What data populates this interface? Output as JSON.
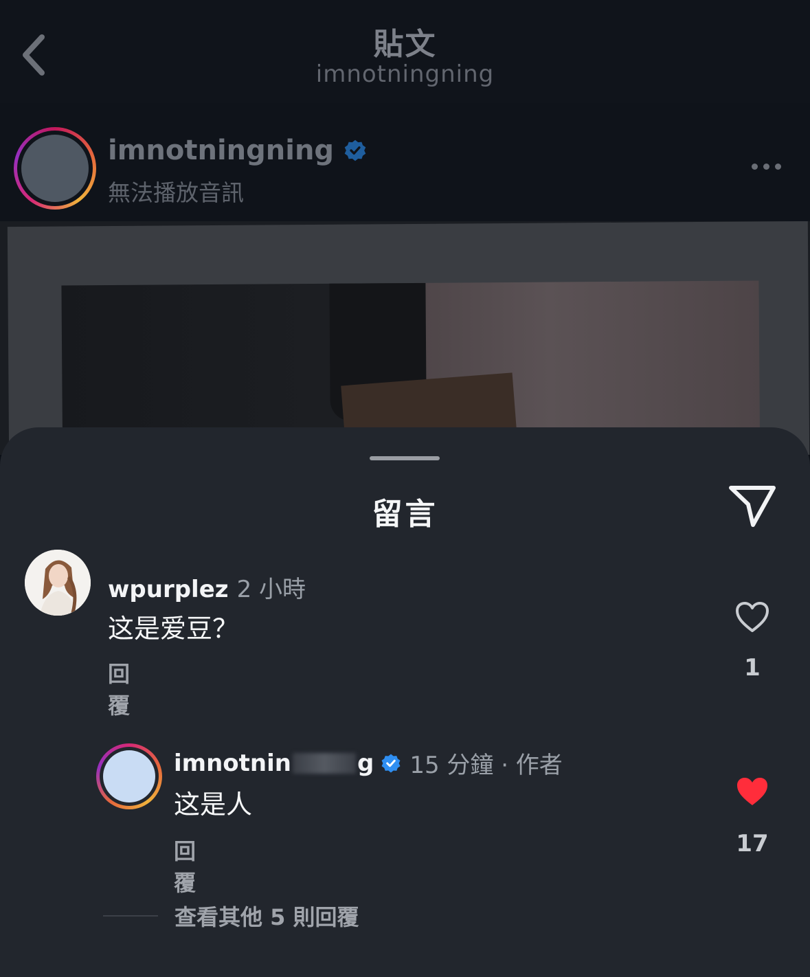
{
  "header": {
    "title": "貼文",
    "subtitle": "imnotningning"
  },
  "post": {
    "username": "imnotningning",
    "audio_status": "無法播放音訊"
  },
  "comments_sheet": {
    "title": "留言",
    "comments": [
      {
        "username": "wpurplez",
        "time": "2 小時",
        "text": "这是爱豆？",
        "reply_label": "回覆",
        "like_count": "1",
        "liked": false
      }
    ],
    "reply": {
      "username_visible_start": "imnotnin",
      "username_visible_end": "g",
      "time_and_role": "15 分鐘 · 作者",
      "text": "这是人",
      "reply_label": "回覆",
      "like_count": "17",
      "liked": true
    },
    "view_more_label": "查看其他 5 則回覆"
  },
  "colors": {
    "background": "#0c1017",
    "sheet": "#22262d",
    "verified_blue": "#2f8ff2",
    "like_red": "#ff2d3b"
  },
  "icons": {
    "back": "chevron-left-icon",
    "more": "more-horizontal-icon",
    "share": "send-icon",
    "like": "heart-icon",
    "verified": "verified-badge-icon"
  }
}
